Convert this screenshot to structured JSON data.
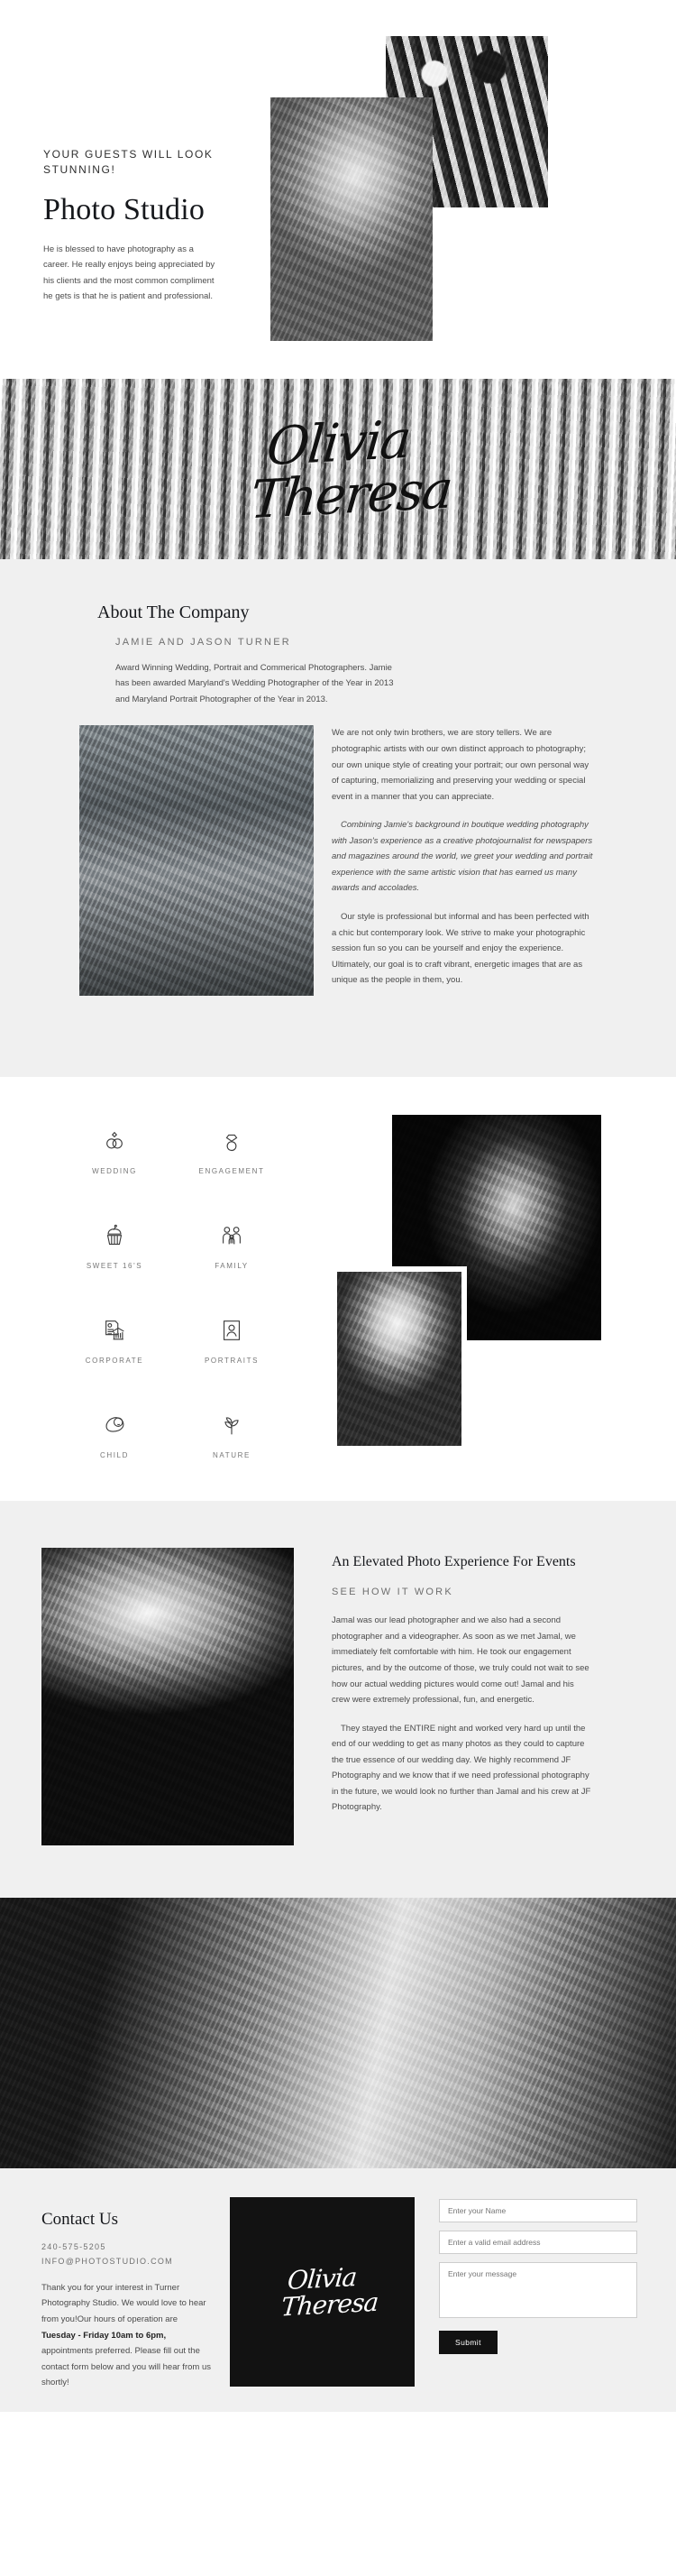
{
  "hero": {
    "kicker": "YOUR GUESTS WILL LOOK STUNNING!",
    "title": "Photo Studio",
    "paragraph": "He is blessed to have photography as a career. He really enjoys being appreciated by his clients and the most common compliment he gets is that he is patient and professional."
  },
  "signature": {
    "line1": "Olivia",
    "line2": "Theresa"
  },
  "about": {
    "title": "About The Company",
    "subtitle": "JAMIE AND JASON TURNER",
    "intro": "Award Winning Wedding, Portrait and Commerical Photographers. Jamie has been awarded Maryland's Wedding Photographer of the Year in 2013 and Maryland Portrait Photographer of the Year in 2013.",
    "paragraphs": [
      "We are not only twin brothers, we are story tellers. We are photographic artists with our own distinct approach to photography; our own unique style of creating your portrait; our own personal way of capturing, memorializing and preserving your wedding or special event in a manner that you can appreciate.",
      "Combining Jamie's background in boutique wedding photography with Jason's experience as a creative photojournalist for newspapers and magazines around the world, we greet your wedding and portrait experience with the same artistic vision that has earned us many awards and accolades.",
      "Our style is professional but informal and has been perfected with a chic but contemporary look. We strive to make your photographic session fun so you can be yourself and enjoy the experience. Ultimately, our goal is to craft vibrant, energetic images that are as unique as the people in them, you."
    ]
  },
  "services": {
    "items": [
      {
        "label": "WEDDING",
        "icon": "wedding-rings-icon"
      },
      {
        "label": "ENGAGEMENT",
        "icon": "diamond-ring-icon"
      },
      {
        "label": "SWEET 16'S",
        "icon": "cupcake-icon"
      },
      {
        "label": "FAMILY",
        "icon": "family-icon"
      },
      {
        "label": "CORPORATE",
        "icon": "corporate-building-icon"
      },
      {
        "label": "PORTRAITS",
        "icon": "portrait-frame-icon"
      },
      {
        "label": "CHILD",
        "icon": "baby-icon"
      },
      {
        "label": "NATURE",
        "icon": "leaf-icon"
      }
    ]
  },
  "events": {
    "title": "An Elevated Photo Experience For Events",
    "subtitle": "SEE HOW IT WORK",
    "paragraphs": [
      "Jamal was our lead photographer and we also had a second photographer and a videographer. As soon as we met Jamal, we immediately felt comfortable with him. He took our engagement pictures, and by the outcome of those, we truly could not wait to see how our actual wedding pictures would come out! Jamal and his crew were extremely professional, fun, and energetic.",
      "They stayed the ENTIRE night and worked very hard up until the end of our wedding to get as many photos as they could to capture the true essence of our wedding day. We highly recommend JF Photography and we know that if we need professional photography in the future, we would look no further than Jamal and his crew at JF Photography."
    ]
  },
  "contact": {
    "title": "Contact Us",
    "phone": "240-575-5205",
    "email": "INFO@PHOTOSTUDIO.COM",
    "blurb_1": "Thank you for your interest in Turner Photography Studio. We would love to hear from you!Our hours of operation are ",
    "blurb_bold": "Tuesday - Friday 10am to 6pm,",
    "blurb_2": " appointments preferred. Please fill out the contact form below and you will hear from us shortly!",
    "card_line1": "Olivia",
    "card_line2": "Theresa",
    "form": {
      "name_placeholder": "Enter your Name",
      "email_placeholder": "Enter a valid email address",
      "message_placeholder": "Enter your message",
      "submit_label": "Submit"
    }
  },
  "colors": {
    "accent_dark": "#121212",
    "page_bg": "#ffffff",
    "section_bg": "#f0f0f0"
  }
}
